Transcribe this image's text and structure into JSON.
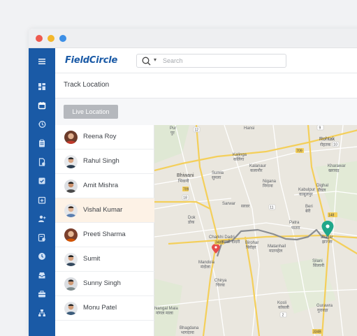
{
  "app": {
    "logo": "FieldCircle",
    "search_placeholder": "Search",
    "page_title": "Track Location",
    "live_button": "Live Location"
  },
  "sidebar": {
    "items": [
      "menu-icon",
      "dashboard-icon",
      "calendar-icon",
      "history-icon",
      "clipboard-icon",
      "document-icon",
      "checklist-icon",
      "calendar-plus-icon",
      "user-add-icon",
      "report-icon",
      "clock-icon",
      "inbox-icon",
      "briefcase-icon",
      "hierarchy-icon"
    ]
  },
  "people": [
    {
      "name": "Reena Roy"
    },
    {
      "name": "Rahul Singh"
    },
    {
      "name": "Amit  Mishra"
    },
    {
      "name": "Vishal Kumar",
      "active": true
    },
    {
      "name": "Preeti Sharma"
    },
    {
      "name": "Sumit"
    },
    {
      "name": "Sunny Singh"
    },
    {
      "name": "Monu Patel"
    }
  ],
  "map": {
    "labels": {
      "pur": "Pur",
      "pur_h": "पुर",
      "hansi": "Hansi",
      "hansi_h": "हांसी",
      "rohtak": "Rohtak",
      "rohtak_h": "रोहतक",
      "kalinga": "Kalinga",
      "kalinga_h": "कलिंगा",
      "kalanaur": "Kalanaur",
      "kalanaur_h": "कलानौर",
      "kharawar": "Kharawar",
      "kharawar_h": "खरावड़",
      "sumla": "Sumla",
      "sumla_h": "सुमला",
      "bhiwani": "Bhiwani",
      "bhiwani_h": "भिवानी",
      "nigana": "Nigana",
      "nigana_h": "निगाना",
      "dighal": "Dighal",
      "dighal_h": "डीघल",
      "kabulpur": "Kabulpur",
      "kabulpur_h": "काबुलपुर",
      "sarwar": "Sarwar",
      "sarwar_h": "सरवर",
      "ber": "Beri",
      "ber_h": "बेरी",
      "dadri": "Charkhi Dadri",
      "dadri_h": "चरखी दादरी",
      "patra": "Patra",
      "patra_h": "पातरा",
      "dok": "Dok",
      "dok_h": "डोक",
      "jhajjar": "Jhajjar",
      "jhajjar_h": "झज्जर",
      "mandola": "Mandola",
      "mandola_h": "मंदोला",
      "birohar": "Birohar",
      "birohar_h": "बिरोहर",
      "matanhail": "Matanhail",
      "matanhail_h": "मातनहेल",
      "silani": "Silani",
      "silani_h": "सिलानी",
      "chirya": "Chirya",
      "chirya_h": "चिरया",
      "nangal": "Nangal Mala",
      "nangal_h": "नांगल माला",
      "kosli": "Kosli",
      "kosli_h": "कोसली",
      "gurawra": "Gurawra",
      "gurawra_h": "गुरावड़ा",
      "bhagdana": "Bhagdana",
      "bhagdana_h": "भागदाना",
      "r12": "12",
      "r709": "709",
      "r9": "9",
      "r10": "10",
      "r18": "18",
      "r348b": "348B",
      "r11": "11",
      "r148": "148",
      "r2": "2",
      "r334b": "334B",
      "r709a": "709"
    }
  },
  "colors": {
    "brand": "#1a5aa6",
    "route": "#8a8d92",
    "start_pin": "#e74c4c",
    "end_pin": "#1fa78a",
    "active_row": "#fdf2e6"
  }
}
